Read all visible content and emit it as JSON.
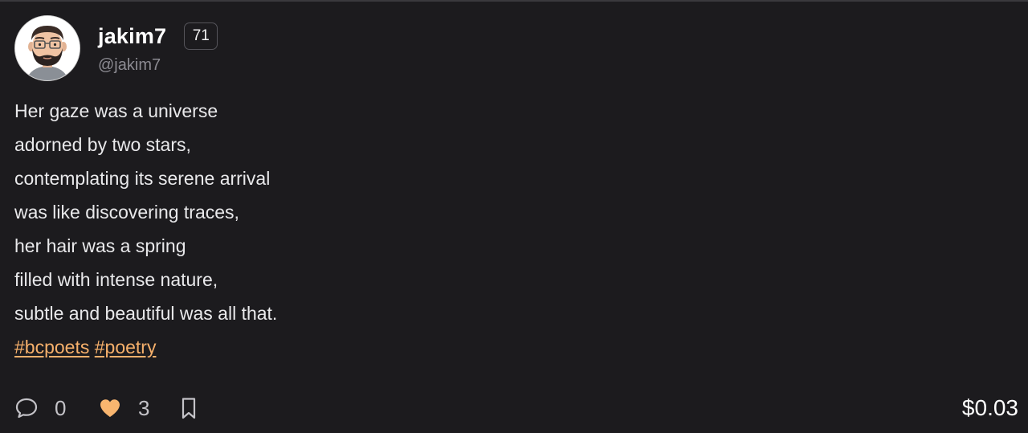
{
  "author": {
    "display_name": "jakim7",
    "handle": "@jakim7",
    "rank": "71",
    "avatar_icon": "cartoon-man-avatar"
  },
  "post": {
    "lines": [
      "Her gaze was a universe",
      "adorned by two stars,",
      "contemplating its serene arrival",
      "was like discovering traces,",
      "her hair was a spring",
      "filled with intense nature,",
      "subtle and beautiful was all that."
    ],
    "tags": [
      "#bcpoets",
      "#poetry"
    ]
  },
  "actions": {
    "comment_icon": "speech-bubble-icon",
    "comment_count": "0",
    "like_icon": "heart-icon",
    "like_count": "3",
    "like_color": "#f8b56f",
    "bookmark_icon": "bookmark-icon"
  },
  "earnings": "$0.03",
  "colors": {
    "background": "#1c1b1e",
    "tag": "#f6b06b"
  }
}
